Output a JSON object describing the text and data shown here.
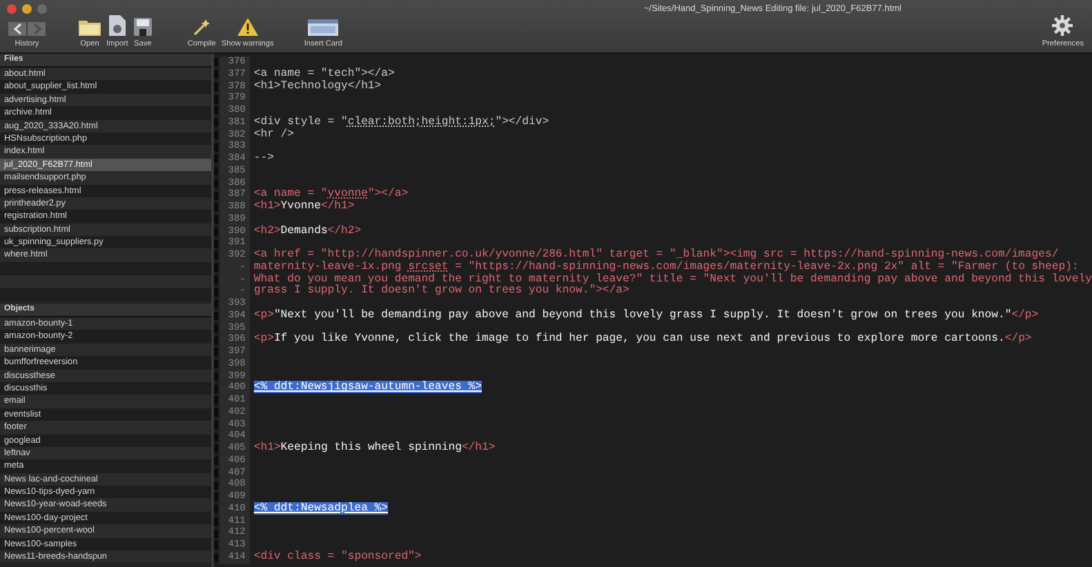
{
  "window": {
    "title": "~/Sites/Hand_Spinning_News Editing file: jul_2020_F62B77.html"
  },
  "toolbar": {
    "left": [
      {
        "kind": "history",
        "label": "History",
        "back_disabled": false,
        "forward_disabled": true
      },
      {
        "kind": "open",
        "label": "Open"
      },
      {
        "kind": "import",
        "label": "Import"
      },
      {
        "kind": "save",
        "label": "Save"
      },
      {
        "kind": "compile",
        "label": "Compile"
      },
      {
        "kind": "warnings",
        "label": "Show warnings"
      },
      {
        "kind": "card",
        "label": "Insert Card"
      }
    ],
    "right": [
      {
        "kind": "preferences",
        "label": "Preferences"
      }
    ]
  },
  "files": {
    "title": "Files",
    "items": [
      {
        "name": "about.html",
        "selected": false
      },
      {
        "name": "about_supplier_list.html",
        "selected": false
      },
      {
        "name": "advertising.html",
        "selected": false
      },
      {
        "name": "archive.html",
        "selected": false
      },
      {
        "name": "aug_2020_333A20.html",
        "selected": false
      },
      {
        "name": "HSNsubscription.php",
        "selected": false
      },
      {
        "name": "index.html",
        "selected": false
      },
      {
        "name": "jul_2020_F62B77.html",
        "selected": true
      },
      {
        "name": "mailsendsupport.php",
        "selected": false
      },
      {
        "name": "press-releases.html",
        "selected": false
      },
      {
        "name": "printheader2.py",
        "selected": false
      },
      {
        "name": "registration.html",
        "selected": false
      },
      {
        "name": "subscription.html",
        "selected": false
      },
      {
        "name": "uk_spinning_suppliers.py",
        "selected": false
      },
      {
        "name": "where.html",
        "selected": false
      }
    ]
  },
  "objects": {
    "title": "Objects",
    "items": [
      {
        "name": "amazon-bounty-1",
        "selected": false
      },
      {
        "name": "amazon-bounty-2",
        "selected": false
      },
      {
        "name": "bannerimage",
        "selected": false
      },
      {
        "name": "bumfforfreeversion",
        "selected": false
      },
      {
        "name": "discussthese",
        "selected": false
      },
      {
        "name": "discussthis",
        "selected": false
      },
      {
        "name": "email",
        "selected": false
      },
      {
        "name": "eventslist",
        "selected": false
      },
      {
        "name": "footer",
        "selected": false
      },
      {
        "name": "googlead",
        "selected": false
      },
      {
        "name": "leftnav",
        "selected": false
      },
      {
        "name": "meta",
        "selected": false
      },
      {
        "name": "News lac-and-cochineal",
        "selected": false
      },
      {
        "name": "News10-tips-dyed-yarn",
        "selected": false
      },
      {
        "name": "News10-year-woad-seeds",
        "selected": false
      },
      {
        "name": "News100-day-project",
        "selected": false
      },
      {
        "name": "News100-percent-wool",
        "selected": false
      },
      {
        "name": "News100-samples",
        "selected": false
      },
      {
        "name": "News11-breeds-handspun",
        "selected": false
      }
    ]
  },
  "editor": {
    "rows": [
      {
        "number": "376"
      },
      {
        "number": "377",
        "segments": [
          {
            "kind": "comment",
            "text": "<a name = \"tech\"></a>"
          }
        ]
      },
      {
        "number": "378",
        "segments": [
          {
            "kind": "comment",
            "text": "<h1>Technology</h1>"
          }
        ]
      },
      {
        "number": "379"
      },
      {
        "number": "380"
      },
      {
        "number": "381",
        "segments": [
          {
            "kind": "comment",
            "text": "<div style = \""
          },
          {
            "kind": "comment_flagged",
            "text": "clear:both;height:1px;"
          },
          {
            "kind": "comment",
            "text": "\"></div>"
          }
        ]
      },
      {
        "number": "382",
        "segments": [
          {
            "kind": "comment",
            "text": "<hr />"
          }
        ]
      },
      {
        "number": "383"
      },
      {
        "number": "384",
        "segments": [
          {
            "kind": "comment",
            "text": "-->"
          }
        ]
      },
      {
        "number": "385"
      },
      {
        "number": "386"
      },
      {
        "number": "387",
        "segments": [
          {
            "kind": "tag",
            "text": "<a name = \""
          },
          {
            "kind": "tag_flagged",
            "text": "yvonne"
          },
          {
            "kind": "tag",
            "text": "\"></a>"
          }
        ]
      },
      {
        "number": "388",
        "segments": [
          {
            "kind": "tag",
            "text": "<h1>"
          },
          {
            "kind": "text",
            "text": "Yvonne"
          },
          {
            "kind": "tag",
            "text": "</h1>"
          }
        ]
      },
      {
        "number": "389"
      },
      {
        "number": "390",
        "segments": [
          {
            "kind": "tag",
            "text": "<h2>"
          },
          {
            "kind": "text",
            "text": "Demands"
          },
          {
            "kind": "tag",
            "text": "</h2>"
          }
        ]
      },
      {
        "number": "391"
      },
      {
        "number": "392",
        "segments": [
          {
            "kind": "tag",
            "text": "<a href = \"http://handspinner.co.uk/yvonne/286.html\" target = \"_blank\"><img src = https://hand-spinning-news.com/images/"
          }
        ]
      },
      {
        "number": "-",
        "segments": [
          {
            "kind": "tag",
            "text": "maternity-leave-1x.png "
          },
          {
            "kind": "tag_flagged",
            "text": "srcset"
          },
          {
            "kind": "tag",
            "text": " = \"https://hand-spinning-news.com/images/maternity-leave-2x.png 2x\" alt = \"Farmer (to sheep):"
          }
        ]
      },
      {
        "number": "-",
        "segments": [
          {
            "kind": "tag",
            "text": "What do you mean you demand the right to maternity leave?\" title = \"Next you'll be demanding pay above and beyond this lovely"
          }
        ]
      },
      {
        "number": "-",
        "segments": [
          {
            "kind": "tag",
            "text": "grass I supply. It doesn't grow on trees you know.\"></a>"
          }
        ]
      },
      {
        "number": "393"
      },
      {
        "number": "394",
        "segments": [
          {
            "kind": "tag",
            "text": "<p>"
          },
          {
            "kind": "text",
            "text": "\"Next you'll be demanding pay above and beyond this lovely grass I supply. It doesn't grow on trees you know.\""
          },
          {
            "kind": "tag",
            "text": "</p>"
          }
        ]
      },
      {
        "number": "395"
      },
      {
        "number": "396",
        "segments": [
          {
            "kind": "tag",
            "text": "<p>"
          },
          {
            "kind": "text",
            "text": "If you like Yvonne, click the image to find her page, you can use next and previous to explore more cartoons."
          },
          {
            "kind": "tag",
            "text": "</p>"
          }
        ]
      },
      {
        "number": "397"
      },
      {
        "number": "398"
      },
      {
        "number": "399"
      },
      {
        "number": "400",
        "segments": [
          {
            "kind": "macro",
            "text": "<% ddt:Newsjigsaw-autumn-leaves %>"
          }
        ]
      },
      {
        "number": "401"
      },
      {
        "number": "402"
      },
      {
        "number": "403"
      },
      {
        "number": "404"
      },
      {
        "number": "405",
        "segments": [
          {
            "kind": "tag",
            "text": "<h1>"
          },
          {
            "kind": "text",
            "text": "Keeping this wheel spinning"
          },
          {
            "kind": "tag",
            "text": "</h1>"
          }
        ]
      },
      {
        "number": "406"
      },
      {
        "number": "407"
      },
      {
        "number": "408"
      },
      {
        "number": "409"
      },
      {
        "number": "410",
        "segments": [
          {
            "kind": "macro",
            "text": "<% ddt:Newsadplea %>"
          }
        ]
      },
      {
        "number": "411"
      },
      {
        "number": "412"
      },
      {
        "number": "413"
      },
      {
        "number": "414",
        "segments": [
          {
            "kind": "tag",
            "text": "<div class = \"sponsored\">"
          }
        ]
      }
    ]
  }
}
